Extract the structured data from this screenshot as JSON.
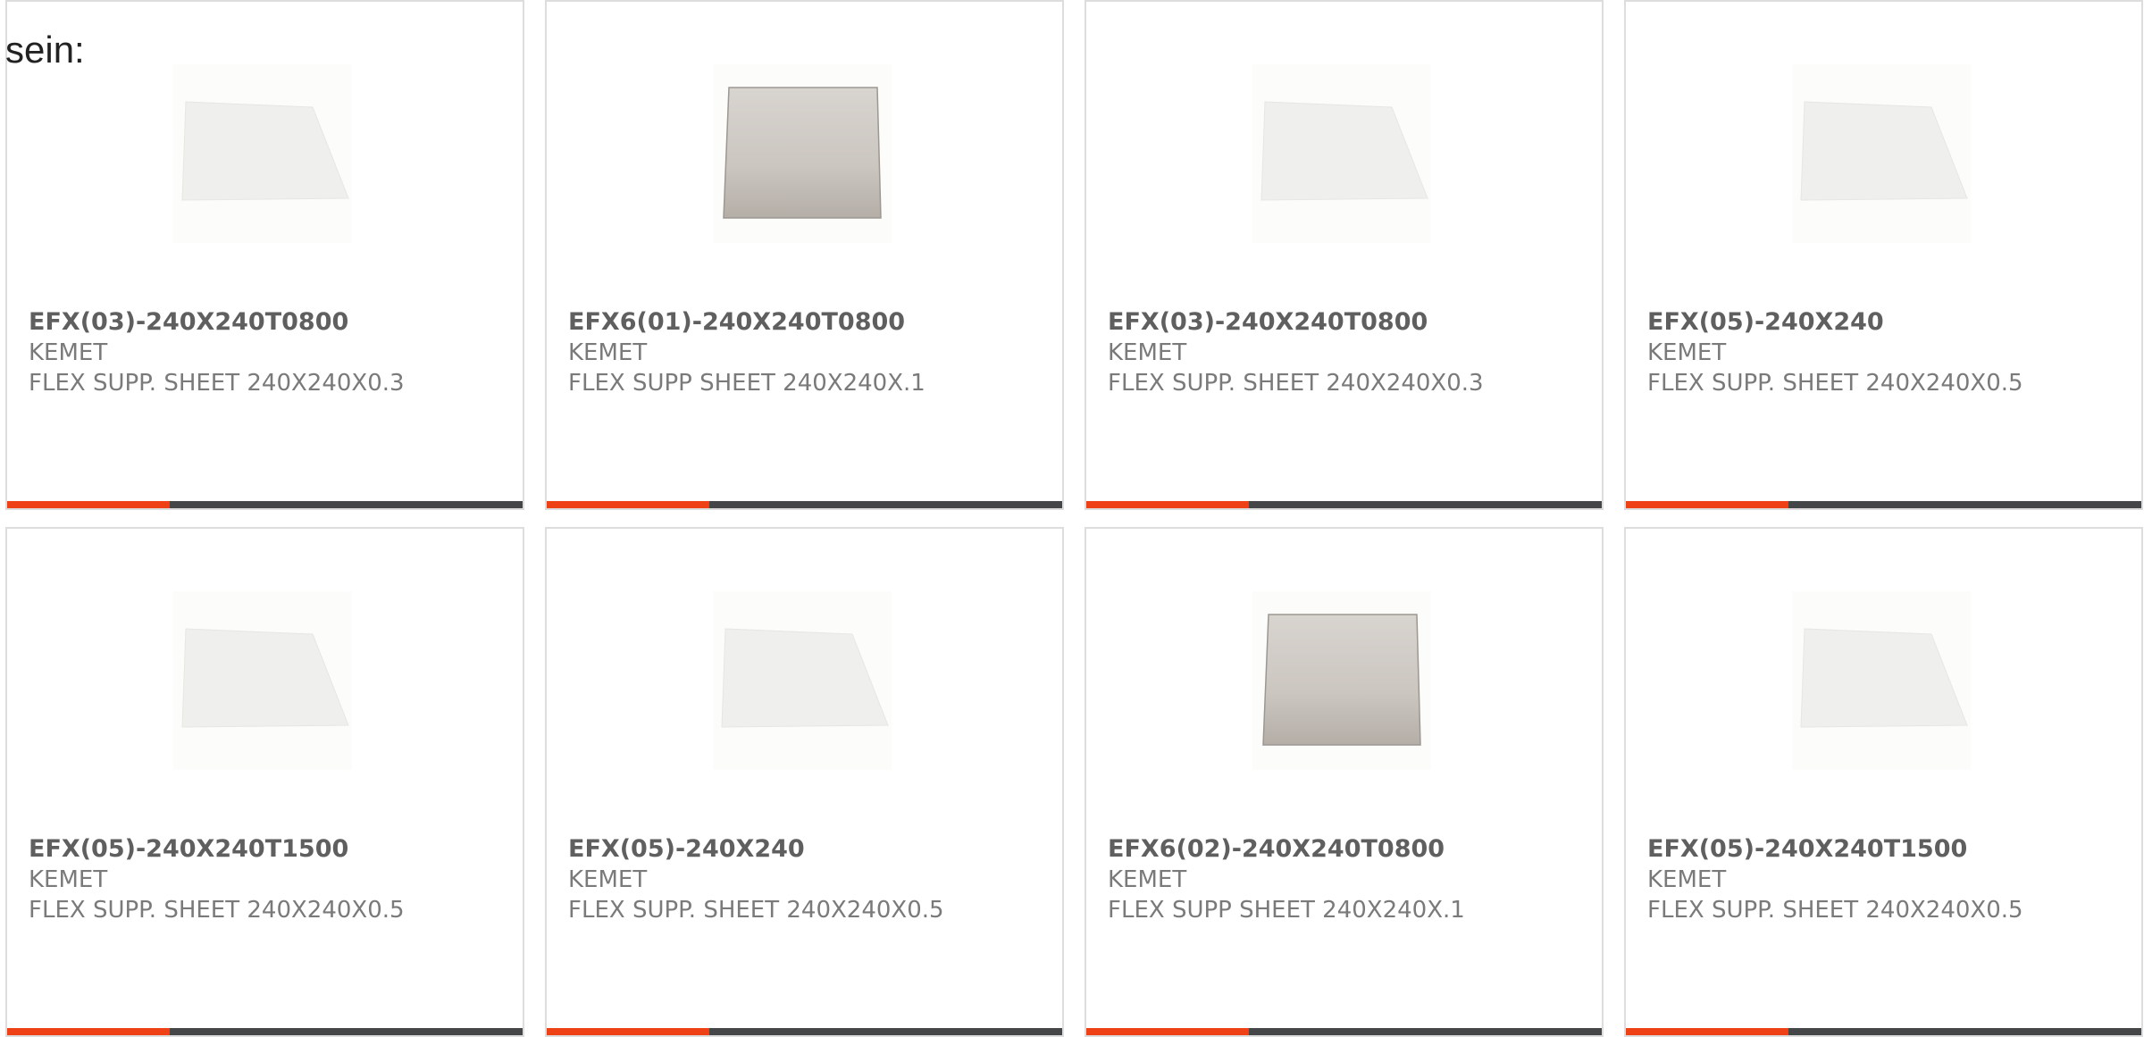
{
  "intro_text": "sein:",
  "colors": {
    "accent": "#ee4216",
    "bar": "#444648",
    "border": "#dddddd",
    "text": "#777777"
  },
  "cards": [
    {
      "part": "EFX(03)-240X240T0800",
      "maker": "KEMET",
      "desc": "FLEX SUPP. SHEET 240X240X0.3",
      "image": "white-flex-sheet"
    },
    {
      "part": "EFX6(01)-240X240T0800",
      "maker": "KEMET",
      "desc": "FLEX SUPP SHEET 240X240X.1",
      "image": "gray-flex-sheet"
    },
    {
      "part": "EFX(03)-240X240T0800",
      "maker": "KEMET",
      "desc": "FLEX SUPP. SHEET 240X240X0.3",
      "image": "white-flex-sheet"
    },
    {
      "part": "EFX(05)-240X240",
      "maker": "KEMET",
      "desc": "FLEX SUPP. SHEET 240X240X0.5",
      "image": "white-flex-sheet"
    },
    {
      "part": "EFX(05)-240X240T1500",
      "maker": "KEMET",
      "desc": "FLEX SUPP. SHEET 240X240X0.5",
      "image": "white-flex-sheet"
    },
    {
      "part": "EFX(05)-240X240",
      "maker": "KEMET",
      "desc": "FLEX SUPP. SHEET 240X240X0.5",
      "image": "white-flex-sheet"
    },
    {
      "part": "EFX6(02)-240X240T0800",
      "maker": "KEMET",
      "desc": "FLEX SUPP SHEET 240X240X.1",
      "image": "gray-flex-sheet"
    },
    {
      "part": "EFX(05)-240X240T1500",
      "maker": "KEMET",
      "desc": "FLEX SUPP. SHEET 240X240X0.5",
      "image": "white-flex-sheet"
    }
  ]
}
